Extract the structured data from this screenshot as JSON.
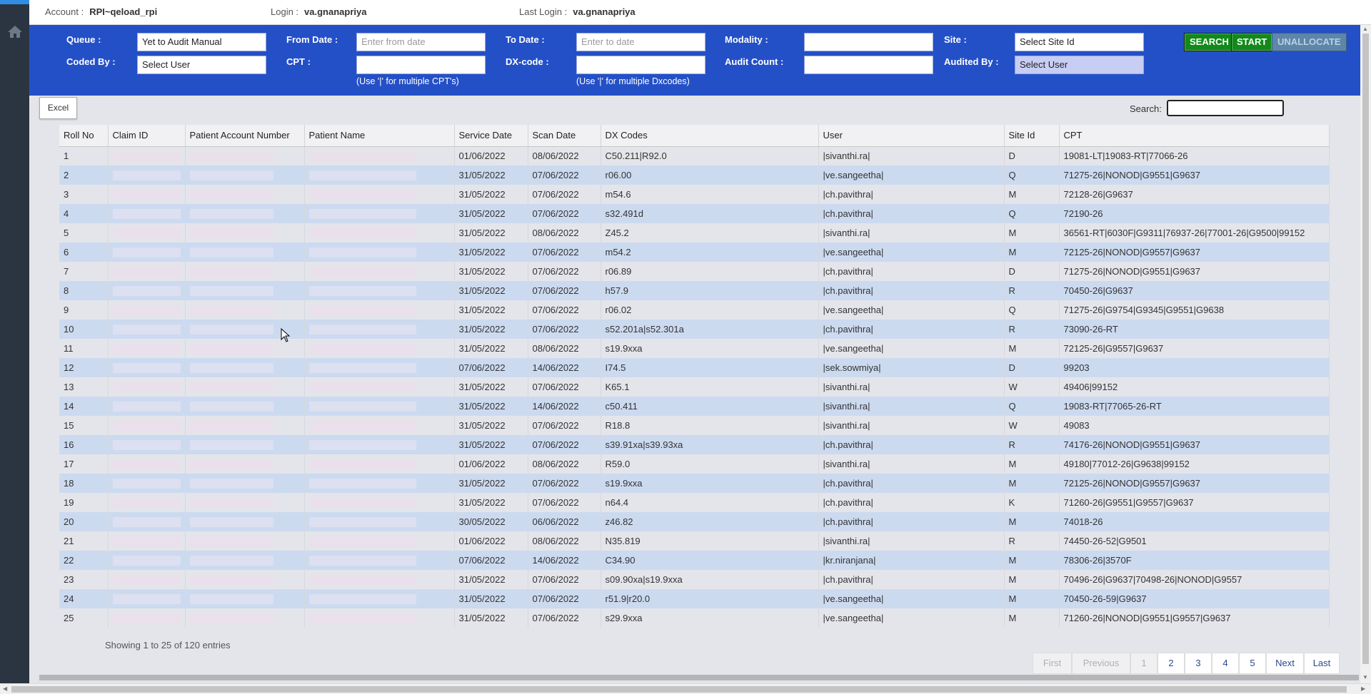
{
  "header": {
    "account_label": "Account :",
    "account_value": "RPI~qeload_rpi",
    "login_label": "Login :",
    "login_value": "va.gnanapriya",
    "last_login_label": "Last Login :",
    "last_login_value": "va.gnanapriya"
  },
  "filters": {
    "queue_label": "Queue :",
    "queue_value": "Yet to Audit Manual",
    "coded_by_label": "Coded By :",
    "coded_by_value": "Select User",
    "from_date_label": "From Date :",
    "from_date_placeholder": "Enter from date",
    "cpt_label": "CPT :",
    "cpt_hint": "(Use '|' for multiple CPT's)",
    "to_date_label": "To Date :",
    "to_date_placeholder": "Enter to date",
    "dx_label": "DX-code :",
    "dx_hint": "(Use '|' for multiple Dxcodes)",
    "modality_label": "Modality :",
    "audit_count_label": "Audit Count :",
    "site_label": "Site :",
    "site_value": "Select Site Id",
    "audited_by_label": "Audited By :",
    "audited_by_value": "Select User",
    "search_button": "SEARCH",
    "start_button": "START",
    "unallocate_button": "UNALLOCATE"
  },
  "toolbar": {
    "excel_label": "Excel",
    "search_label": "Search:"
  },
  "table": {
    "columns": [
      "Roll No",
      "Claim ID",
      "Patient Account Number",
      "Patient Name",
      "Service Date",
      "Scan Date",
      "DX Codes",
      "User",
      "Site Id",
      "CPT"
    ],
    "rows": [
      {
        "roll": "1",
        "service": "01/06/2022",
        "scan": "08/06/2022",
        "dx": "C50.211|R92.0",
        "user": "|sivanthi.ra|",
        "site": "D",
        "cpt": "19081-LT|19083-RT|77066-26"
      },
      {
        "roll": "2",
        "service": "31/05/2022",
        "scan": "07/06/2022",
        "dx": "r06.00",
        "user": "|ve.sangeetha|",
        "site": "Q",
        "cpt": "71275-26|NONOD|G9551|G9637"
      },
      {
        "roll": "3",
        "service": "31/05/2022",
        "scan": "07/06/2022",
        "dx": "m54.6",
        "user": "|ch.pavithra|",
        "site": "M",
        "cpt": "72128-26|G9637"
      },
      {
        "roll": "4",
        "service": "31/05/2022",
        "scan": "07/06/2022",
        "dx": "s32.491d",
        "user": "|ch.pavithra|",
        "site": "Q",
        "cpt": "72190-26"
      },
      {
        "roll": "5",
        "service": "31/05/2022",
        "scan": "08/06/2022",
        "dx": "Z45.2",
        "user": "|sivanthi.ra|",
        "site": "M",
        "cpt": "36561-RT|6030F|G9311|76937-26|77001-26|G9500|99152"
      },
      {
        "roll": "6",
        "service": "31/05/2022",
        "scan": "07/06/2022",
        "dx": "m54.2",
        "user": "|ve.sangeetha|",
        "site": "M",
        "cpt": "72125-26|NONOD|G9557|G9637"
      },
      {
        "roll": "7",
        "service": "31/05/2022",
        "scan": "07/06/2022",
        "dx": "r06.89",
        "user": "|ch.pavithra|",
        "site": "D",
        "cpt": "71275-26|NONOD|G9551|G9637"
      },
      {
        "roll": "8",
        "service": "31/05/2022",
        "scan": "07/06/2022",
        "dx": "h57.9",
        "user": "|ch.pavithra|",
        "site": "R",
        "cpt": "70450-26|G9637"
      },
      {
        "roll": "9",
        "service": "31/05/2022",
        "scan": "07/06/2022",
        "dx": "r06.02",
        "user": "|ve.sangeetha|",
        "site": "Q",
        "cpt": "71275-26|G9754|G9345|G9551|G9638"
      },
      {
        "roll": "10",
        "service": "31/05/2022",
        "scan": "07/06/2022",
        "dx": "s52.201a|s52.301a",
        "user": "|ch.pavithra|",
        "site": "R",
        "cpt": "73090-26-RT"
      },
      {
        "roll": "11",
        "service": "31/05/2022",
        "scan": "08/06/2022",
        "dx": "s19.9xxa",
        "user": "|ve.sangeetha|",
        "site": "M",
        "cpt": "72125-26|G9557|G9637"
      },
      {
        "roll": "12",
        "service": "07/06/2022",
        "scan": "14/06/2022",
        "dx": "I74.5",
        "user": "|sek.sowmiya|",
        "site": "D",
        "cpt": "99203"
      },
      {
        "roll": "13",
        "service": "31/05/2022",
        "scan": "07/06/2022",
        "dx": "K65.1",
        "user": "|sivanthi.ra|",
        "site": "W",
        "cpt": "49406|99152"
      },
      {
        "roll": "14",
        "service": "31/05/2022",
        "scan": "14/06/2022",
        "dx": "c50.411",
        "user": "|sivanthi.ra|",
        "site": "Q",
        "cpt": "19083-RT|77065-26-RT"
      },
      {
        "roll": "15",
        "service": "31/05/2022",
        "scan": "07/06/2022",
        "dx": "R18.8",
        "user": "|sivanthi.ra|",
        "site": "W",
        "cpt": "49083"
      },
      {
        "roll": "16",
        "service": "31/05/2022",
        "scan": "07/06/2022",
        "dx": "s39.91xa|s39.93xa",
        "user": "|ch.pavithra|",
        "site": "R",
        "cpt": "74176-26|NONOD|G9551|G9637"
      },
      {
        "roll": "17",
        "service": "01/06/2022",
        "scan": "08/06/2022",
        "dx": "R59.0",
        "user": "|sivanthi.ra|",
        "site": "M",
        "cpt": "49180|77012-26|G9638|99152"
      },
      {
        "roll": "18",
        "service": "31/05/2022",
        "scan": "07/06/2022",
        "dx": "s19.9xxa",
        "user": "|ch.pavithra|",
        "site": "M",
        "cpt": "72125-26|NONOD|G9557|G9637"
      },
      {
        "roll": "19",
        "service": "31/05/2022",
        "scan": "07/06/2022",
        "dx": "n64.4",
        "user": "|ch.pavithra|",
        "site": "K",
        "cpt": "71260-26|G9551|G9557|G9637"
      },
      {
        "roll": "20",
        "service": "30/05/2022",
        "scan": "06/06/2022",
        "dx": "z46.82",
        "user": "|ch.pavithra|",
        "site": "M",
        "cpt": "74018-26"
      },
      {
        "roll": "21",
        "service": "01/06/2022",
        "scan": "08/06/2022",
        "dx": "N35.819",
        "user": "|sivanthi.ra|",
        "site": "R",
        "cpt": "74450-26-52|G9501"
      },
      {
        "roll": "22",
        "service": "07/06/2022",
        "scan": "14/06/2022",
        "dx": "C34.90",
        "user": "|kr.niranjana|",
        "site": "M",
        "cpt": "78306-26|3570F"
      },
      {
        "roll": "23",
        "service": "31/05/2022",
        "scan": "07/06/2022",
        "dx": "s09.90xa|s19.9xxa",
        "user": "|ch.pavithra|",
        "site": "M",
        "cpt": "70496-26|G9637|70498-26|NONOD|G9557"
      },
      {
        "roll": "24",
        "service": "31/05/2022",
        "scan": "07/06/2022",
        "dx": "r51.9|r20.0",
        "user": "|ve.sangeetha|",
        "site": "M",
        "cpt": "70450-26-59|G9637"
      },
      {
        "roll": "25",
        "service": "31/05/2022",
        "scan": "07/06/2022",
        "dx": "s29.9xxa",
        "user": "|ve.sangeetha|",
        "site": "M",
        "cpt": "71260-26|NONOD|G9551|G9557|G9637"
      }
    ]
  },
  "footer": {
    "entries_text": "Showing 1 to 25 of 120 entries",
    "first": "First",
    "previous": "Previous",
    "pages": [
      "1",
      "2",
      "3",
      "4",
      "5"
    ],
    "next": "Next",
    "last": "Last"
  },
  "icons": {
    "home": "home-icon",
    "cursor": "mouse-pointer-icon"
  },
  "colors": {
    "filter_panel": "#2450c7",
    "rail": "#2b3541",
    "row_even": "#ccdaf0",
    "row_odd": "#e4e5ea",
    "button_green": "#118a1a"
  }
}
